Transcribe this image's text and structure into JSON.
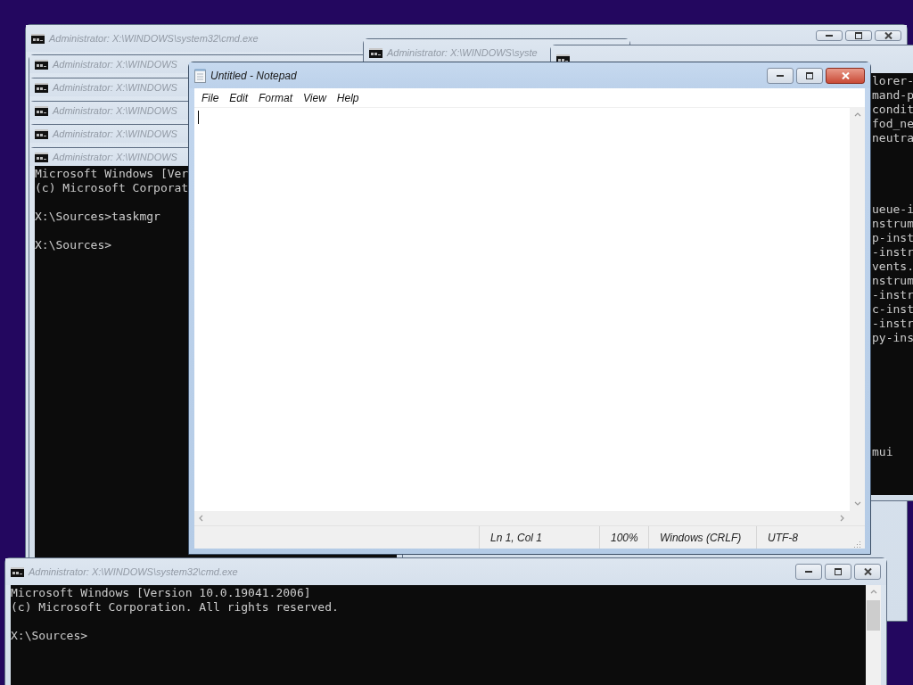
{
  "desktop": {
    "windows": [
      {
        "kind": "console",
        "title": "Administrator: X:\\WINDOWS\\system32\\cmd.exe",
        "active": false
      },
      {
        "kind": "console",
        "title": "Administrator: X:\\WINDOWS",
        "active": false
      },
      {
        "kind": "console",
        "title": "Administrator: X:\\WINDOWS",
        "active": false
      },
      {
        "kind": "console",
        "title": "Administrator: X:\\WINDOWS",
        "active": false
      },
      {
        "kind": "console",
        "title": "Administrator: X:\\WINDOWS",
        "active": false
      },
      {
        "kind": "console",
        "title": "Administrator: X:\\WINDOWS",
        "active": false,
        "lines": [
          {
            "kind": "text",
            "text": "Microsoft Windows [Ver"
          },
          {
            "kind": "text",
            "text": "(c) Microsoft Corporat"
          },
          {
            "kind": "blank"
          },
          {
            "kind": "text",
            "text": "X:\\Sources>taskmgr"
          },
          {
            "kind": "blank"
          },
          {
            "kind": "text",
            "text": "X:\\Sources>"
          }
        ]
      },
      {
        "kind": "console",
        "title": "Administrator: X:\\WINDOWS\\syste",
        "active": false
      },
      {
        "kind": "notepad",
        "title": "Untitled - Notepad",
        "active": true,
        "menu": [
          "File",
          "Edit",
          "Format",
          "View",
          "Help"
        ],
        "status_bar": [
          "Ln 1, Col 1",
          "100%",
          "Windows (CRLF)",
          "UTF-8"
        ]
      },
      {
        "kind": "console",
        "active": false,
        "lines": [
          {
            "kind": "text",
            "text": "lorer-"
          },
          {
            "kind": "text",
            "text": "mand-p"
          },
          {
            "kind": "text",
            "text": "condit"
          },
          {
            "kind": "text",
            "text": "fod_ne"
          },
          {
            "kind": "text",
            "text": "neutra"
          },
          {
            "kind": "blank"
          },
          {
            "kind": "blank"
          },
          {
            "kind": "blank"
          },
          {
            "kind": "blank"
          },
          {
            "kind": "text",
            "text": "ueue-i"
          },
          {
            "kind": "text",
            "text": "nstrum"
          },
          {
            "kind": "text",
            "text": "p-inst"
          },
          {
            "kind": "text",
            "text": "-instr"
          },
          {
            "kind": "text",
            "text": "vents."
          },
          {
            "kind": "text",
            "text": "nstrum"
          },
          {
            "kind": "text",
            "text": "-instr"
          },
          {
            "kind": "text",
            "text": "c-inst"
          },
          {
            "kind": "text",
            "text": "-instr"
          },
          {
            "kind": "text",
            "text": "py-ins"
          },
          {
            "kind": "blank"
          },
          {
            "kind": "blank"
          },
          {
            "kind": "blank"
          },
          {
            "kind": "blank"
          },
          {
            "kind": "blank"
          },
          {
            "kind": "blank"
          },
          {
            "kind": "blank"
          },
          {
            "kind": "text",
            "text": "mui"
          }
        ]
      },
      {
        "kind": "console",
        "title": "Administrator: X:\\WINDOWS\\system32\\cmd.exe",
        "active": false,
        "lines": [
          {
            "kind": "text",
            "text": "Microsoft Windows [Version 10.0.19041.2006]"
          },
          {
            "kind": "text",
            "text": "(c) Microsoft Corporation. All rights reserved."
          },
          {
            "kind": "blank"
          },
          {
            "kind": "text",
            "text": "X:\\Sources>"
          }
        ]
      }
    ]
  }
}
